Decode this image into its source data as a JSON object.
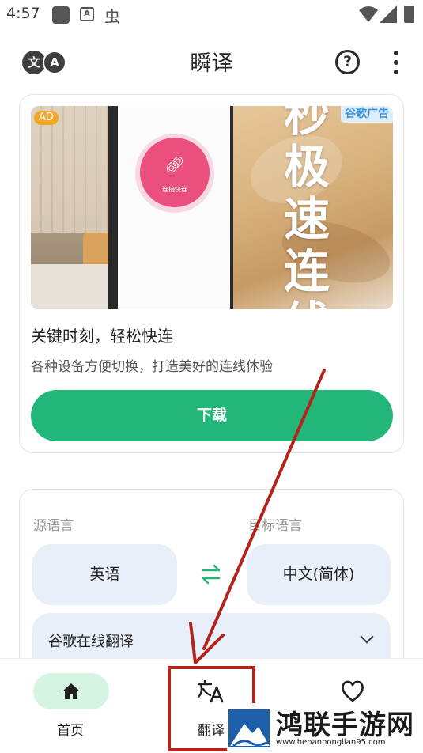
{
  "status_bar": {
    "time": "4:57",
    "icons": [
      "notification-square-icon",
      "a-box-icon",
      "bug-icon",
      "wifi-icon",
      "signal-icon",
      "battery-icon"
    ]
  },
  "app_bar": {
    "title": "瞬译",
    "logo_left": "文",
    "logo_right": "A",
    "help_glyph": "?"
  },
  "ad": {
    "badge": "AD",
    "google_label": "谷歌广告",
    "image_text": "秒极速连线",
    "image_small_text": "连接快连",
    "title": "关键时刻，轻松快连",
    "description": "各种设备方便切换，打造美好的连线体验",
    "button": "下载"
  },
  "translator": {
    "source_label": "源语言",
    "target_label": "目标语言",
    "source_language": "英语",
    "target_language": "中文(简体)",
    "engine": "谷歌在线翻译"
  },
  "bottom_nav": {
    "items": [
      {
        "label": "首页",
        "icon": "home-icon",
        "active": true
      },
      {
        "label": "翻译",
        "icon": "translate-icon",
        "active": false
      },
      {
        "label": "",
        "icon": "heart-icon",
        "active": false
      }
    ]
  },
  "watermark": {
    "title": "鸿联手游网",
    "url": "www.henanhonglian95.com"
  },
  "colors": {
    "accent_green": "#22b778",
    "active_pill": "#d5f5e2",
    "lang_button_bg": "#e9eff8",
    "annotation_red": "#b3241c",
    "ad_badge": "#f5a623"
  }
}
